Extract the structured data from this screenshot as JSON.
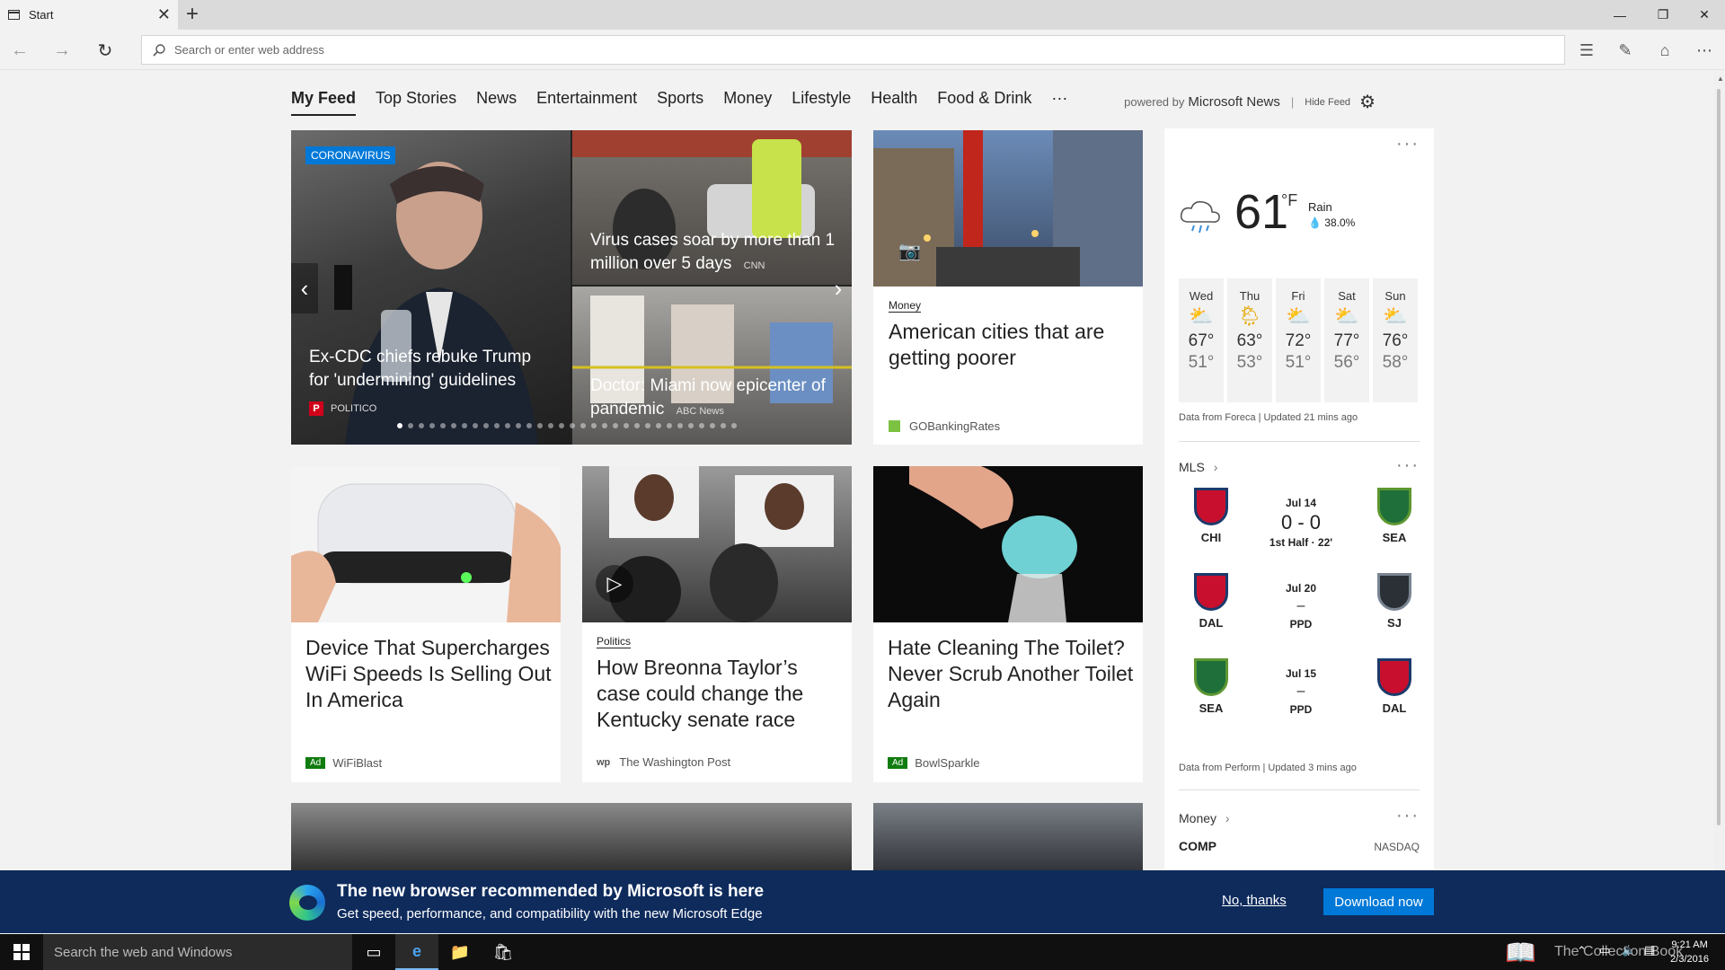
{
  "browser": {
    "tab_title": "Start",
    "address_placeholder": "Search or enter web address"
  },
  "feed_nav": {
    "items": [
      "My Feed",
      "Top Stories",
      "News",
      "Entertainment",
      "Sports",
      "Money",
      "Lifestyle",
      "Health",
      "Food & Drink",
      "···"
    ],
    "powered_prefix": "powered by",
    "powered_brand": "Microsoft News",
    "hide_feed": "Hide Feed"
  },
  "hero": {
    "badge": "CORONAVIRUS",
    "main_title": "Ex-CDC chiefs rebuke Trump for 'undermining' guidelines",
    "main_source": "POLITICO",
    "top_right_title": "Virus cases soar by more than 1 million over 5 days",
    "top_right_source": "CNN",
    "bottom_right_title": "Doctor: Miami now epicenter of pandemic",
    "bottom_right_source": "ABC News",
    "carousel_dot_count": 32,
    "carousel_active_index": 0
  },
  "cards": {
    "chicago": {
      "kicker": "Money",
      "title": "American cities that are getting poorer",
      "source": "GOBankingRates"
    },
    "wifi": {
      "badge": "Ad",
      "title": "Device That Supercharges WiFi Speeds Is Selling Out In America",
      "source": "WiFiBlast"
    },
    "breonna": {
      "kicker": "Politics",
      "title": "How Breonna Taylor’s case could change the Kentucky senate race",
      "source": "The Washington Post",
      "source_logo": "wp"
    },
    "toilet": {
      "badge": "Ad",
      "title": "Hate Cleaning The Toilet? Never Scrub Another Toilet Again",
      "source": "BowlSparkle"
    }
  },
  "weather": {
    "temp": "61",
    "unit": "°F",
    "condition": "Rain",
    "precip": "38.0%",
    "forecast": [
      {
        "day": "Wed",
        "hi": "67°",
        "lo": "51°"
      },
      {
        "day": "Thu",
        "hi": "63°",
        "lo": "53°"
      },
      {
        "day": "Fri",
        "hi": "72°",
        "lo": "51°"
      },
      {
        "day": "Sat",
        "hi": "77°",
        "lo": "56°"
      },
      {
        "day": "Sun",
        "hi": "76°",
        "lo": "58°"
      }
    ],
    "note": "Data from Foreca | Updated 21 mins ago"
  },
  "mls": {
    "title": "MLS",
    "matches": [
      {
        "home": "CHI",
        "away": "SEA",
        "date": "Jul 14",
        "score": "0 - 0",
        "status": "1st Half · 22'"
      },
      {
        "home": "DAL",
        "away": "SJ",
        "date": "Jul 20",
        "score": "–",
        "status": "PPD"
      },
      {
        "home": "SEA",
        "away": "DAL",
        "date": "Jul 15",
        "score": "–",
        "status": "PPD"
      }
    ],
    "note": "Data from Perform | Updated 3 mins ago"
  },
  "money": {
    "title": "Money",
    "symbol": "COMP",
    "exchange": "NASDAQ"
  },
  "banner": {
    "title": "The new browser recommended by Microsoft is here",
    "subtitle": "Get speed, performance, and compatibility with the new Microsoft Edge",
    "no_thanks": "No, thanks",
    "download": "Download now"
  },
  "taskbar": {
    "search_placeholder": "Search the web and Windows",
    "watermark": "The Collection Book",
    "time": "9:21 AM",
    "date": "2/3/2016"
  },
  "colors": {
    "accent": "#0078d7",
    "banner_bg": "#0e2b5c",
    "ad_green": "#107c10"
  }
}
